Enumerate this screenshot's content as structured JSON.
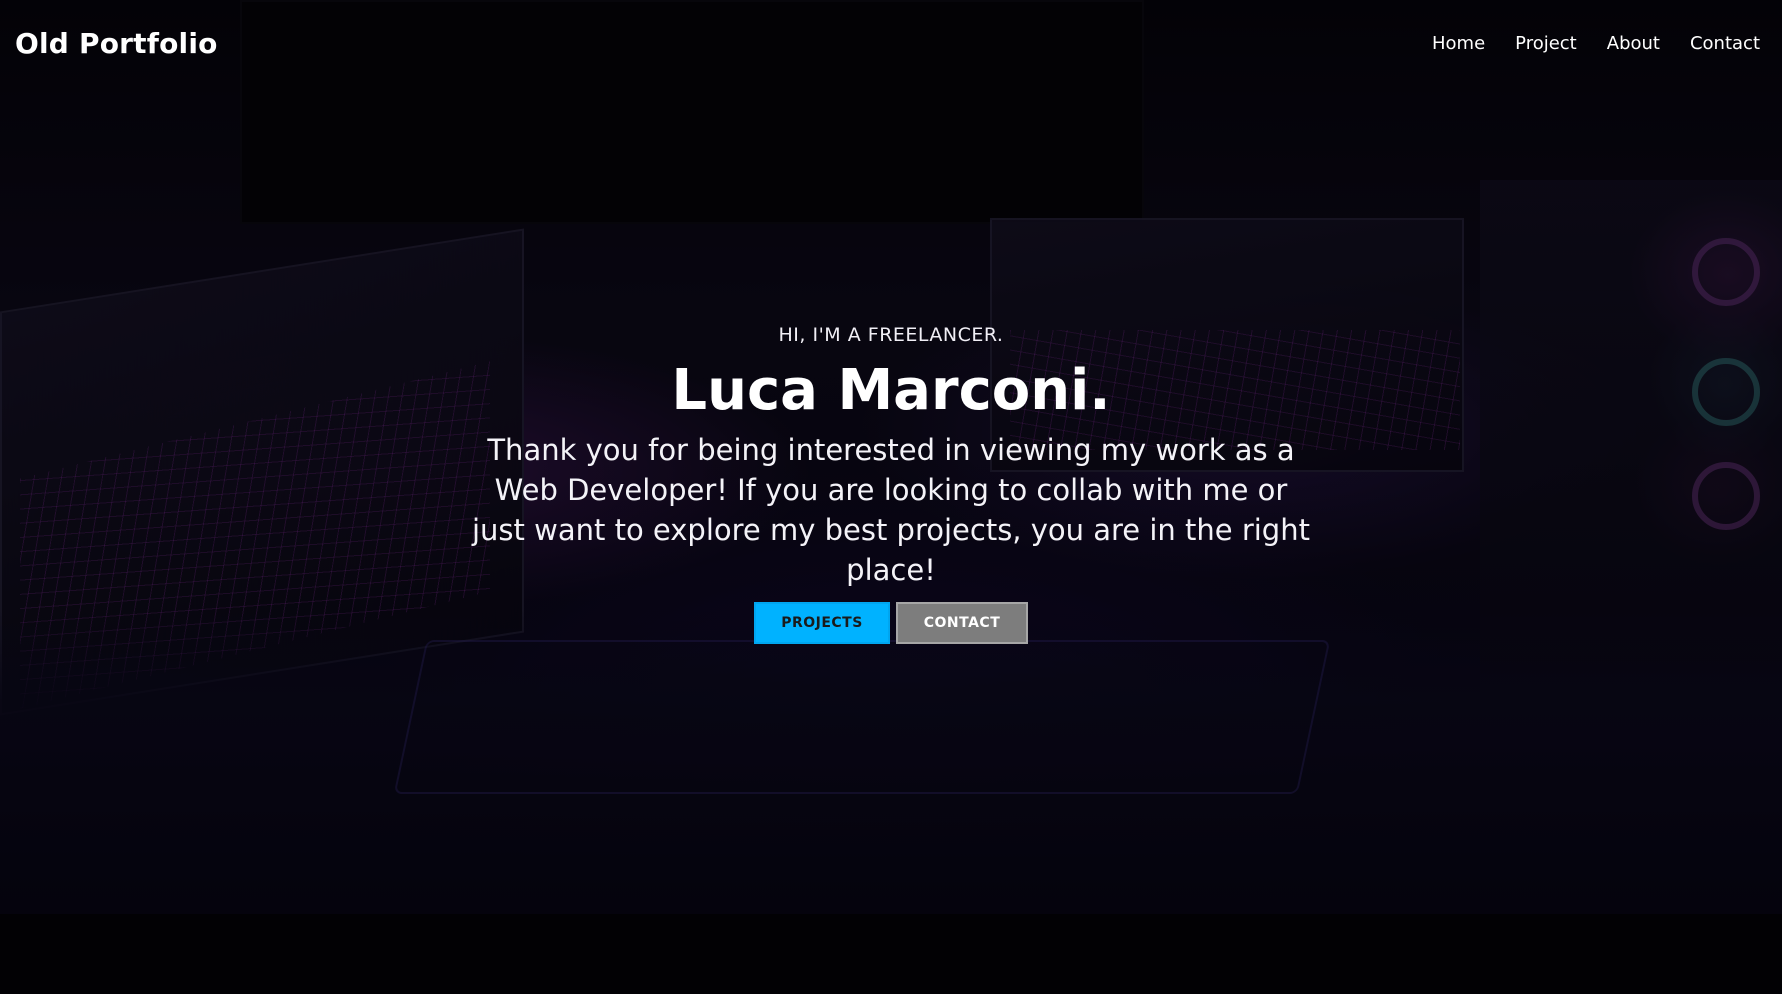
{
  "navbar": {
    "brand": "Old Portfolio",
    "links": [
      {
        "label": "Home"
      },
      {
        "label": "Project"
      },
      {
        "label": "About"
      },
      {
        "label": "Contact"
      }
    ]
  },
  "hero": {
    "intro": "HI, I'M A FREELANCER.",
    "name": "Luca Marconi.",
    "description": "Thank you for being interested in viewing my work as a Web Developer! If you are looking to collab with me or just want to explore my best projects, you are in the right place!",
    "buttons": {
      "projects": "PROJECTS",
      "contact": "CONTACT"
    }
  },
  "colors": {
    "accent": "#00b2ff",
    "secondary_button": "#7d7d7d",
    "background": "#020104",
    "text": "#ffffff"
  }
}
